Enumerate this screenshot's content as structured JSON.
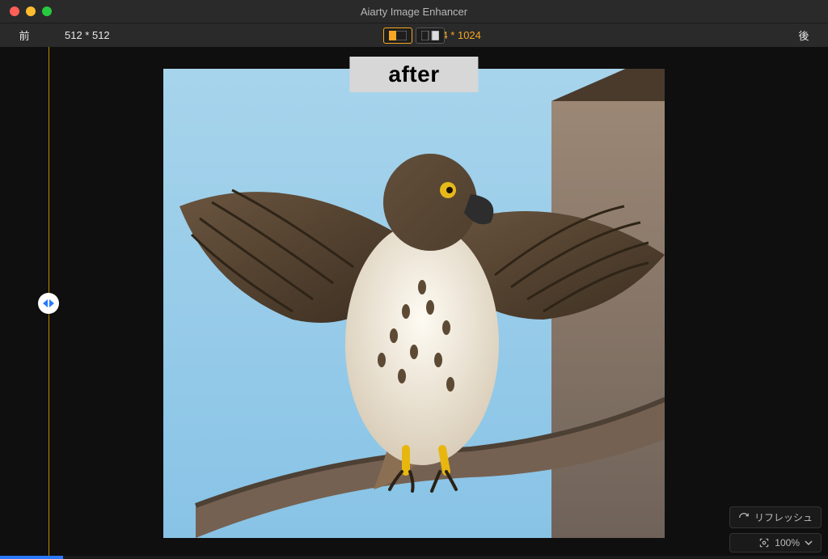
{
  "titlebar": {
    "app_title": "Aiarty Image Enhancer"
  },
  "toolbar": {
    "before_label": "前",
    "before_dim": "512 * 512",
    "after_label": "後",
    "after_dim": "1024 * 1024",
    "view_mode": "single"
  },
  "preview": {
    "badge": "after",
    "subject": "hawk with spread wings on branch"
  },
  "controls": {
    "refresh_label": "リフレッシュ",
    "zoom_value": "100%"
  }
}
